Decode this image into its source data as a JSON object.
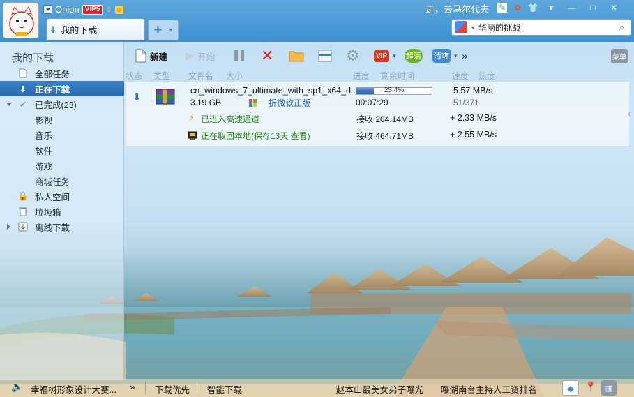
{
  "header": {
    "user_name": "Onion",
    "vip_badge": "VIP5",
    "slogan": "走，去马尔代夫",
    "tab_label": "我的下载",
    "add_tab_symbol": "+",
    "search_value": "华丽的挑战"
  },
  "sidebar": {
    "title": "我的下载",
    "items": [
      {
        "label": "全部任务"
      },
      {
        "label": "正在下载"
      },
      {
        "label": "已完成(23)"
      },
      {
        "label": "影视"
      },
      {
        "label": "音乐"
      },
      {
        "label": "软件"
      },
      {
        "label": "游戏"
      },
      {
        "label": "商城任务"
      },
      {
        "label": "私人空间"
      },
      {
        "label": "垃圾箱"
      },
      {
        "label": "离线下载"
      }
    ]
  },
  "toolbar": {
    "new_label": "新建",
    "start_label": "开始",
    "vip_label": "VIP",
    "chaoqing_label": "超清",
    "qingshuang_label": "清爽",
    "more_symbol": "»",
    "menu_label": "菜单"
  },
  "columns": [
    "状态",
    "类型",
    "文件名",
    "大小",
    "进度",
    "剩余时间",
    "速度",
    "热度"
  ],
  "task": {
    "filename": "cn_windows_7_ultimate_with_sp1_x64_d...",
    "size": "3.19 GB",
    "promo": "一折微软正版",
    "progress_text": "23.4%",
    "progress": 0.234,
    "remaining": "00:07:29",
    "speed": "5.57 MB/s",
    "peers": "51/371",
    "channel1_label": "已进入高速通道",
    "channel1_received": "接收 204.14MB",
    "channel1_speed": "+ 2.33 MB/s",
    "channel2_label": "正在取回本地(保存13天 查看)",
    "channel2_received": "接收 464.71MB",
    "channel2_speed": "+ 2.55 MB/s"
  },
  "statusbar": {
    "news1": "幸福树形象设计大赛...",
    "more_symbol": "»",
    "download_priority": "下载优先",
    "smart_download": "智能下载",
    "news2": "赵本山最美女弟子曝光",
    "news3": "曝湖南台主持人工资排名"
  },
  "colors": {
    "accent": "#2b6db0",
    "title_bar": "#4a9ad6",
    "promo_link": "#1c62b8",
    "green_text": "#2a8a1a"
  }
}
